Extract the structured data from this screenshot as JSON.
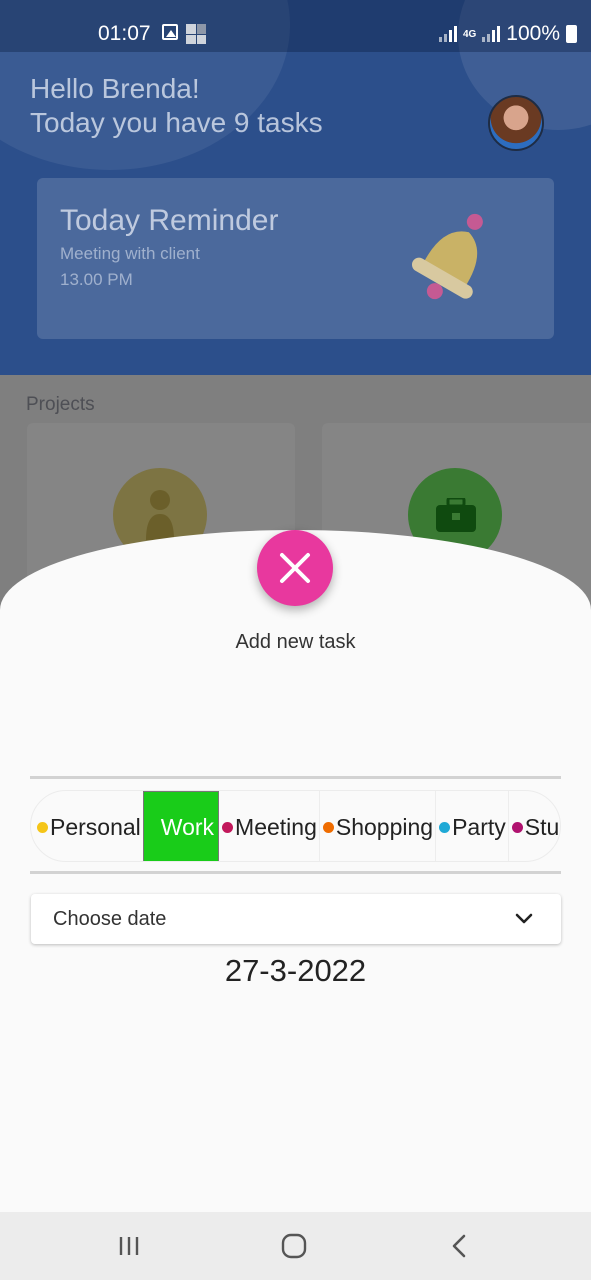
{
  "status_bar": {
    "time": "01:07",
    "network": "4G",
    "battery": "100%"
  },
  "header": {
    "greeting_line1": "Hello Brenda!",
    "greeting_line2": "Today you have 9 tasks"
  },
  "reminder": {
    "title": "Today Reminder",
    "subtitle": "Meeting with client",
    "time": "13.00 PM"
  },
  "projects": {
    "label": "Projects"
  },
  "sheet": {
    "title": "Add new task",
    "categories": [
      {
        "label": "Personal",
        "color": "#f5c518",
        "selected": false
      },
      {
        "label": "Work",
        "color": "#19cc19",
        "selected": true
      },
      {
        "label": "Meeting",
        "color": "#c2185b",
        "selected": false
      },
      {
        "label": "Shopping",
        "color": "#ef6c00",
        "selected": false
      },
      {
        "label": "Party",
        "color": "#1fa9d6",
        "selected": false
      },
      {
        "label": "Stud",
        "color": "#b0126f",
        "selected": false
      }
    ],
    "date_dropdown_label": "Choose date",
    "selected_date": "27-3-2022"
  },
  "colors": {
    "accent_pink": "#e8389e",
    "selected_green": "#19cc19",
    "header_blue": "#2c4f8b"
  }
}
